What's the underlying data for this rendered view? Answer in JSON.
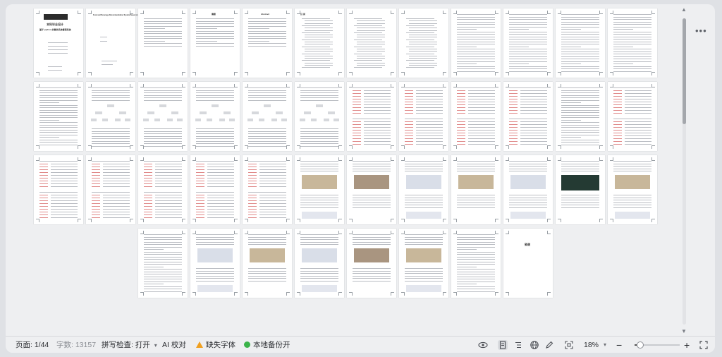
{
  "status_bar": {
    "page_label": "页面: 1/44",
    "word_count": "字数: 13157",
    "spell_check": "拼写检查: 打开",
    "ai_check": "AI 校对",
    "missing_fonts": "缺失字体",
    "local_backup": "本地备份开",
    "zoom": "18%",
    "zoom_minus": "−",
    "zoom_plus": "+"
  },
  "icons": {
    "spell_dropdown": "chevron-down-icon",
    "missing_fonts": "warning-icon",
    "backup": "backup-status-icon",
    "eye": "eye-icon",
    "page_view": "page-view-icon",
    "outline": "outline-icon",
    "web": "globe-icon",
    "pen": "pen-icon",
    "fit": "fit-page-icon",
    "fullscreen": "fullscreen-icon",
    "more": "more-icon"
  },
  "document": {
    "cover_title": "本科毕业设计",
    "cover_subtitle": "基于 python 的餐饮系统管理系统",
    "cover_en_title": "Food and Beverage Recommendation System Based on Python",
    "toc_heading": "目 录",
    "abstract_heading": "摘要",
    "abstract_en_heading": "Abstract",
    "last_page_heading": "致谢"
  },
  "colors": {
    "accent_red": "#e08a8a",
    "warning": "#f0a020",
    "ok": "#3bb34a"
  }
}
